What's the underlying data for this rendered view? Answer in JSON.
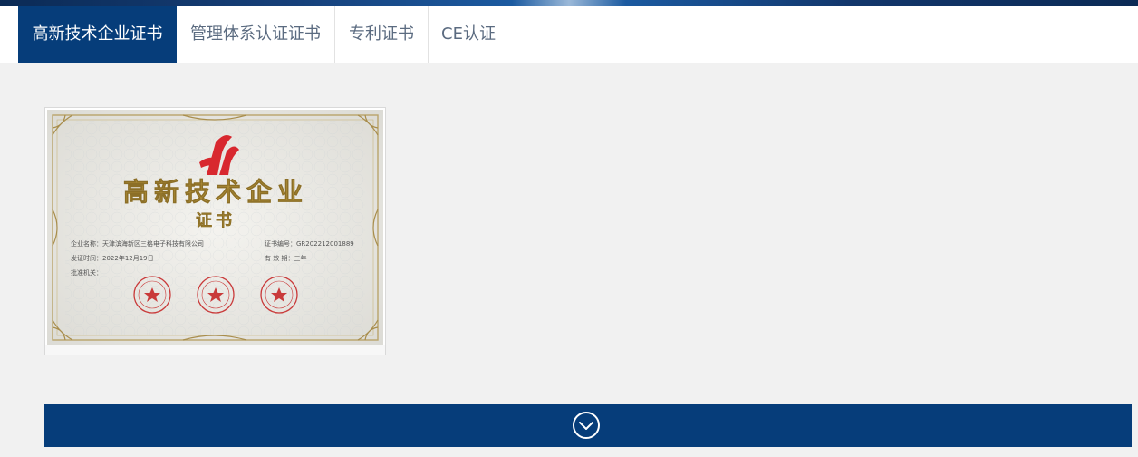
{
  "tabs": [
    {
      "label": "高新技术企业证书",
      "active": true
    },
    {
      "label": "管理体系认证证书",
      "active": false
    },
    {
      "label": "专利证书",
      "active": false
    },
    {
      "label": "CE认证",
      "active": false
    }
  ],
  "certificate": {
    "title": "高新技术企业",
    "subtitle": "证书",
    "company_label": "企业名称：天津滨海新区三格电子科技有限公司",
    "number_label": "证书编号：GR202212001889",
    "date_label": "发证时间：2022年12月19日",
    "validity_label": "有 效 期：三年",
    "authority_label": "批准机关："
  },
  "icons": {
    "expand": "chevron-down-circle-icon"
  },
  "colors": {
    "accent": "#063d7a",
    "tab_text": "#5b6b80",
    "background": "#f1f1f1",
    "logo_red": "#d8282f",
    "title_gold": "#b8973d"
  }
}
